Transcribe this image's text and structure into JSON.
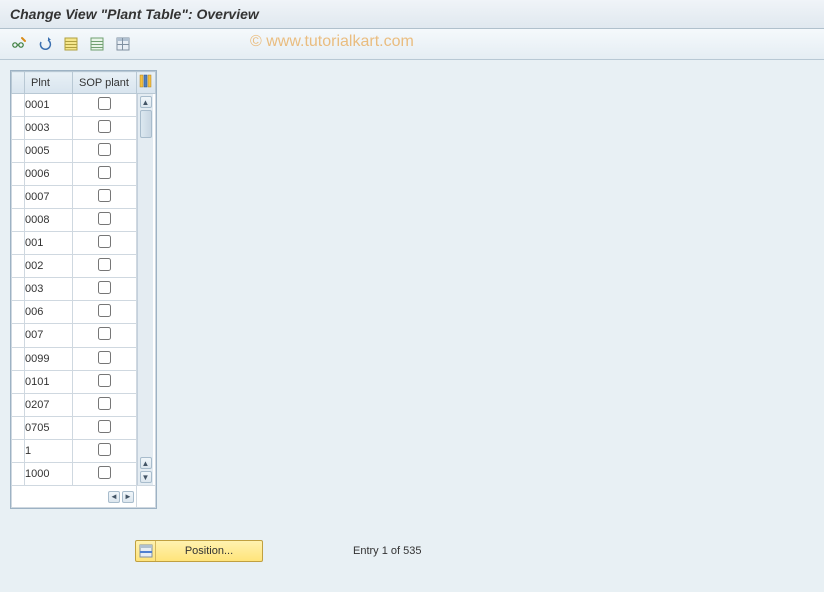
{
  "title": "Change View \"Plant Table\": Overview",
  "watermark": "© www.tutorialkart.com",
  "toolbar": {
    "buttons": [
      "change-display-toggle",
      "undo-change",
      "select-all",
      "deselect-all",
      "config-button"
    ]
  },
  "table": {
    "columns": {
      "plnt": "Plnt",
      "sop": "SOP plant"
    },
    "rows": [
      {
        "plnt": "0001",
        "sop": false
      },
      {
        "plnt": "0003",
        "sop": false
      },
      {
        "plnt": "0005",
        "sop": false
      },
      {
        "plnt": "0006",
        "sop": false
      },
      {
        "plnt": "0007",
        "sop": false
      },
      {
        "plnt": "0008",
        "sop": false
      },
      {
        "plnt": "001",
        "sop": false
      },
      {
        "plnt": "002",
        "sop": false
      },
      {
        "plnt": "003",
        "sop": false
      },
      {
        "plnt": "006",
        "sop": false
      },
      {
        "plnt": "007",
        "sop": false
      },
      {
        "plnt": "0099",
        "sop": false
      },
      {
        "plnt": "0101",
        "sop": false
      },
      {
        "plnt": "0207",
        "sop": false
      },
      {
        "plnt": "0705",
        "sop": false
      },
      {
        "plnt": "1",
        "sop": false
      },
      {
        "plnt": "1000",
        "sop": false
      }
    ]
  },
  "footer": {
    "position_label": "Position...",
    "entry_status": "Entry 1 of 535"
  }
}
